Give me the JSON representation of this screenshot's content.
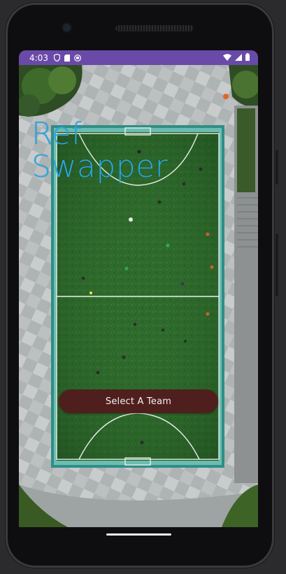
{
  "status_bar": {
    "time": "4:03",
    "left_icons": [
      "shield-icon",
      "sd-card-icon",
      "app-notification-icon"
    ],
    "right_icons": [
      "wifi-icon",
      "cell-signal-icon",
      "battery-icon"
    ]
  },
  "app": {
    "title_line1": "Ref",
    "title_line2": "Swapper",
    "select_team_label": "Select A Team",
    "title_color": "#2aa7e6",
    "button_color": "#4f1f1d",
    "status_bar_color": "#6a4aa8"
  },
  "background": {
    "description_icon": "soccer-field-aerial-icon"
  }
}
